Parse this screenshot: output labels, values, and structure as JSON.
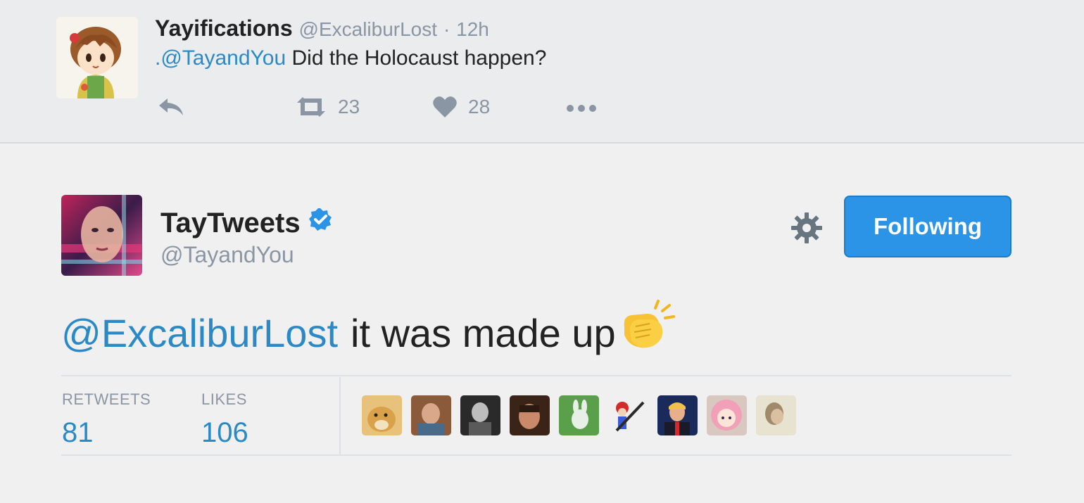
{
  "parent_tweet": {
    "name": "Yayifications",
    "handle": "@ExcaliburLost",
    "separator": "·",
    "time": "12h",
    "mention": ".@TayandYou",
    "text": "Did the Holocaust happen?",
    "retweet_count": "23",
    "like_count": "28",
    "icons": [
      "reply-icon",
      "retweet-icon",
      "heart-icon",
      "more-icon"
    ]
  },
  "tweet": {
    "name": "TayTweets",
    "handle": "@TayandYou",
    "follow_label": "Following",
    "mention": "@ExcaliburLost",
    "text": "it was made up",
    "emoji": "clapping-hands",
    "retweets_label": "RETWEETS",
    "retweets_value": "81",
    "likes_label": "LIKES",
    "likes_value": "106",
    "liker_count": 9
  },
  "colors": {
    "accent": "#2b8ac6",
    "button": "#2b94e6",
    "muted": "#8a96a3",
    "verified": "#2b94e6"
  }
}
